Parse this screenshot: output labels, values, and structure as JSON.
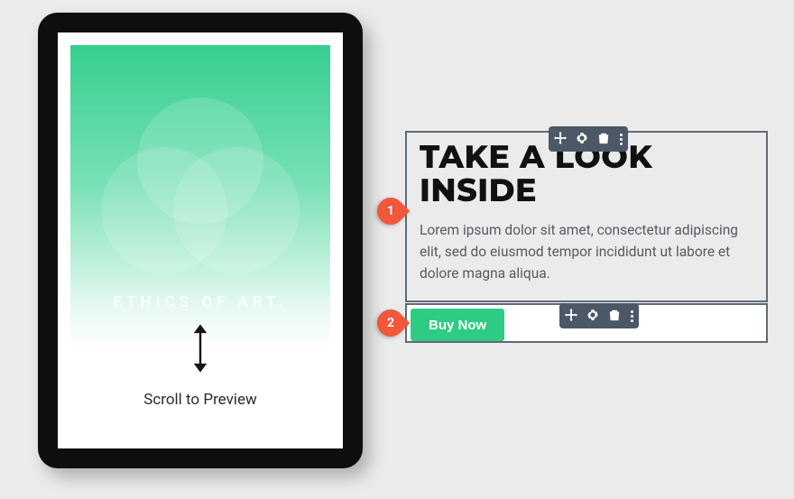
{
  "cover": {
    "title": "ETHICS OF ART.",
    "scroll_label": "Scroll to Preview"
  },
  "text_block": {
    "heading": "TAKE A LOOK INSIDE",
    "body": "Lorem ipsum dolor sit amet, consectetur adipiscing elit, sed do eiusmod tempor incididunt ut labore et dolore magna aliqua."
  },
  "button_block": {
    "label": "Buy Now"
  },
  "badges": {
    "one": "1",
    "two": "2"
  },
  "toolbar": {
    "icons": {
      "move": "move-icon",
      "settings": "gear-icon",
      "delete": "trash-icon",
      "more": "more-icon"
    }
  }
}
